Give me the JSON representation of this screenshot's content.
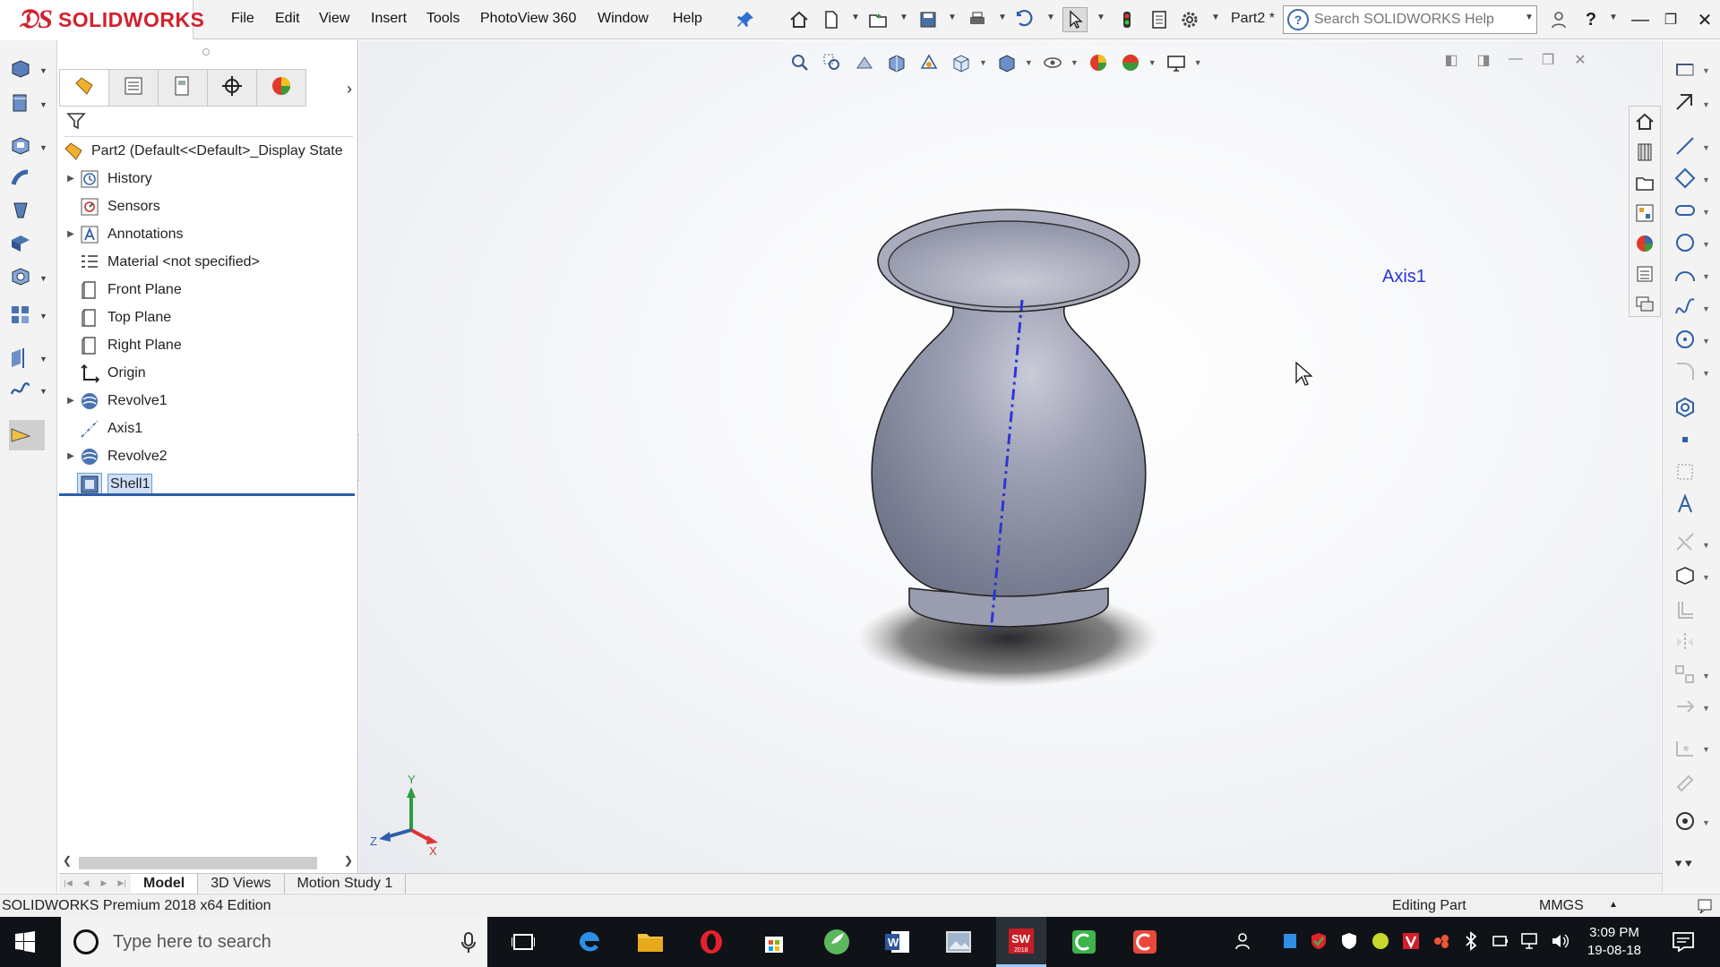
{
  "app": {
    "brand": "SOLIDWORKS",
    "doc_title": "Part2 *",
    "help_search_placeholder": "Search SOLIDWORKS Help"
  },
  "menu": [
    "File",
    "Edit",
    "View",
    "Insert",
    "Tools",
    "PhotoView 360",
    "Window",
    "Help"
  ],
  "feature_tree": {
    "root": "Part2  (Default<<Default>_Display State",
    "items": [
      {
        "label": "History",
        "icon": "history-icon",
        "expandable": true
      },
      {
        "label": "Sensors",
        "icon": "sensors-icon",
        "expandable": false
      },
      {
        "label": "Annotations",
        "icon": "annotations-icon",
        "expandable": true
      },
      {
        "label": "Material <not specified>",
        "icon": "material-icon",
        "expandable": false
      },
      {
        "label": "Front Plane",
        "icon": "plane-icon",
        "expandable": false
      },
      {
        "label": "Top Plane",
        "icon": "plane-icon",
        "expandable": false
      },
      {
        "label": "Right Plane",
        "icon": "plane-icon",
        "expandable": false
      },
      {
        "label": "Origin",
        "icon": "origin-icon",
        "expandable": false
      },
      {
        "label": "Revolve1",
        "icon": "revolve-icon",
        "expandable": true
      },
      {
        "label": "Axis1",
        "icon": "axis-icon",
        "expandable": false
      },
      {
        "label": "Revolve2",
        "icon": "revolve-icon",
        "expandable": true
      },
      {
        "label": "Shell1",
        "icon": "shell-icon",
        "expandable": false,
        "selected": true
      }
    ]
  },
  "viewport": {
    "axis_label": "Axis1",
    "triad": {
      "x": "X",
      "y": "Y",
      "z": "Z"
    }
  },
  "model_tabs": [
    {
      "label": "Model",
      "active": true
    },
    {
      "label": "3D Views",
      "active": false
    },
    {
      "label": "Motion Study 1",
      "active": false
    }
  ],
  "status": {
    "edition": "SOLIDWORKS Premium 2018 x64 Edition",
    "mode": "Editing Part",
    "units": "MMGS"
  },
  "taskbar": {
    "search_placeholder": "Type here to search",
    "time": "3:09 PM",
    "date": "19-08-18"
  },
  "colors": {
    "brand_red": "#d3202e",
    "axis_blue": "#2b35d6",
    "selection_blue": "#cfe0f7",
    "model_gray": "#8e92a3"
  }
}
